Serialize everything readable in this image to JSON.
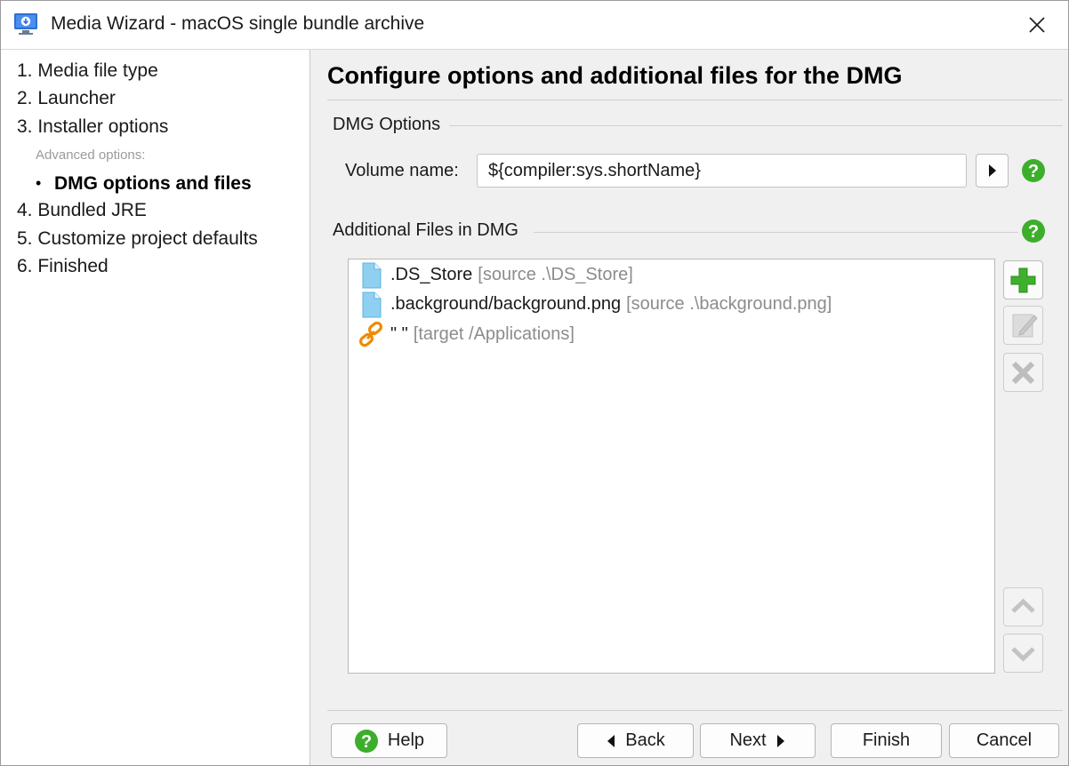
{
  "window": {
    "title": "Media Wizard - macOS single bundle archive",
    "app_icon": "media-wizard-icon",
    "close_icon": "close-icon"
  },
  "sidebar": {
    "steps": [
      {
        "label": "1. Media file type"
      },
      {
        "label": "2. Launcher"
      },
      {
        "label": "3. Installer options"
      },
      {
        "label": "4. Bundled JRE"
      },
      {
        "label": "5. Customize project defaults"
      },
      {
        "label": "6. Finished"
      }
    ],
    "advanced_caption": "Advanced options:",
    "bullet": "•",
    "current_step": "DMG options and files"
  },
  "main": {
    "heading": "Configure options and additional files for the DMG",
    "dmg_options": {
      "section_title": "DMG Options",
      "volume_name_label": "Volume name:",
      "volume_name_value": "${compiler:sys.shortName}"
    },
    "additional_files": {
      "section_title": "Additional Files in DMG",
      "items": [
        {
          "icon": "file-icon",
          "name": ".DS_Store",
          "meta": "[source .\\DS_Store]"
        },
        {
          "icon": "file-icon",
          "name": ".background/background.png",
          "meta": "[source .\\background.png]"
        },
        {
          "icon": "link-icon",
          "name": "\" \"",
          "meta": "[target /Applications]"
        }
      ]
    }
  },
  "buttons": {
    "help": "Help",
    "back": "Back",
    "next": "Next",
    "finish": "Finish",
    "cancel": "Cancel"
  },
  "colors": {
    "help_green": "#3dae2b",
    "add_green": "#3fb02d",
    "link_orange": "#f08a00",
    "file_blue": "#8fd0f0",
    "disabled_gray": "#bdbdbd"
  }
}
